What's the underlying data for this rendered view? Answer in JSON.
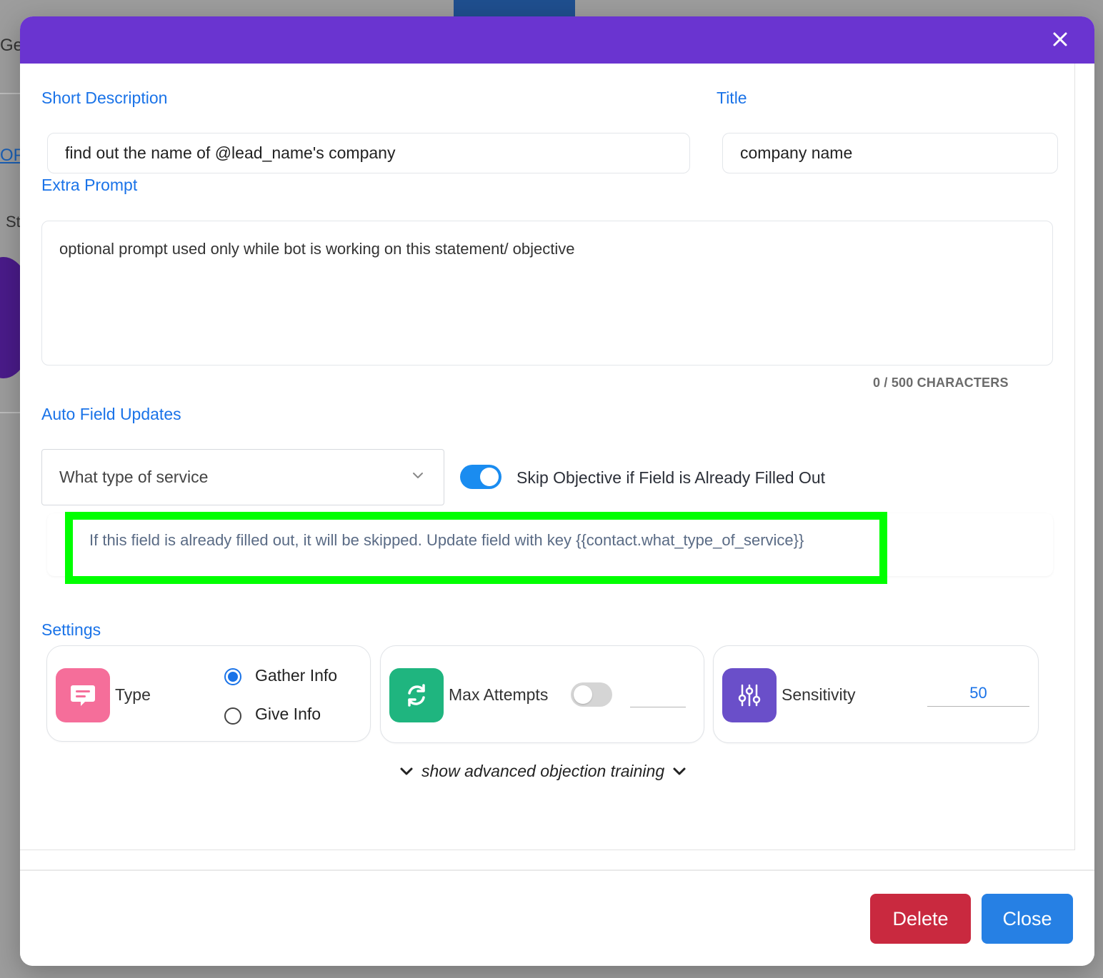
{
  "background": {
    "partial_text_1": "Ge",
    "partial_link": "OP",
    "partial_text_2": "St"
  },
  "form": {
    "short_description_label": "Short Description",
    "short_description_value": "find out the name of @lead_name's company",
    "title_label": "Title",
    "title_value": "company name",
    "extra_prompt_label": "Extra Prompt",
    "extra_prompt_value": "optional prompt used only while bot is working on this statement/ objective",
    "char_count": "0 / 500 CHARACTERS"
  },
  "auto_field": {
    "label": "Auto Field Updates",
    "selected": "What type of service",
    "skip_toggle_label": "Skip Objective if Field is Already Filled Out",
    "skip_toggle_on": true,
    "info": "If this field is already filled out, it will be skipped. Update field with key {{contact.what_type_of_service}}"
  },
  "settings": {
    "label": "Settings",
    "type": {
      "label": "Type",
      "icon": "chat-message-icon",
      "options": [
        "Gather Info",
        "Give Info"
      ],
      "selected": "Gather Info"
    },
    "max_attempts": {
      "label": "Max Attempts",
      "icon": "refresh-icon",
      "enabled": false,
      "value": ""
    },
    "sensitivity": {
      "label": "Sensitivity",
      "icon": "sliders-icon",
      "value": "50"
    }
  },
  "advanced_link": "show advanced objection training",
  "footer": {
    "delete_label": "Delete",
    "close_label": "Close"
  },
  "colors": {
    "header": "#6a34d0",
    "accent": "#1a73e8",
    "type_icon": "#f56e9a",
    "max_attempts_icon": "#1fb57f",
    "sensitivity_icon": "#6a4fc9",
    "delete": "#c9293f",
    "close": "#2680e4",
    "highlight": "#00ff00"
  }
}
